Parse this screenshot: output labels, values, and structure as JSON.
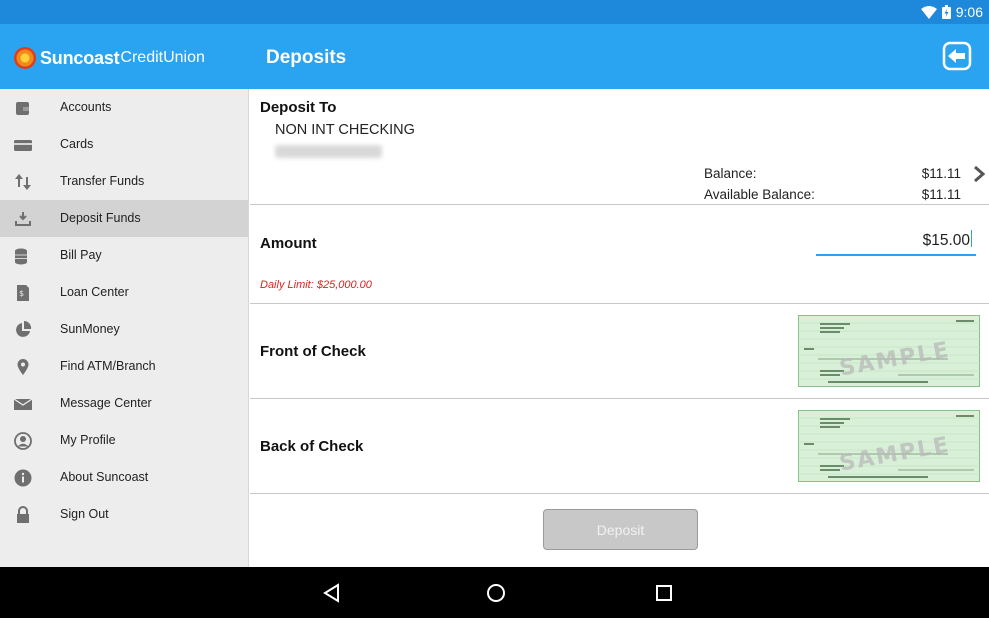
{
  "status_bar": {
    "time": "9:06",
    "wifi_icon": "wifi-icon",
    "battery_icon": "battery-icon"
  },
  "app_bar": {
    "logo_bold": "Suncoast",
    "logo_light": "CreditUnion",
    "title": "Deposits",
    "exit_icon": "logout-icon"
  },
  "sidebar": {
    "items": [
      {
        "label": "Accounts",
        "icon": "wallet-icon"
      },
      {
        "label": "Cards",
        "icon": "credit-card-icon"
      },
      {
        "label": "Transfer Funds",
        "icon": "transfer-arrows-icon"
      },
      {
        "label": "Deposit Funds",
        "icon": "deposit-tray-icon",
        "active": true
      },
      {
        "label": "Bill Pay",
        "icon": "coins-stack-icon"
      },
      {
        "label": "Loan Center",
        "icon": "loan-document-icon"
      },
      {
        "label": "SunMoney",
        "icon": "pie-chart-icon"
      },
      {
        "label": "Find ATM/Branch",
        "icon": "map-pin-icon"
      },
      {
        "label": "Message Center",
        "icon": "envelope-icon"
      },
      {
        "label": "My Profile",
        "icon": "user-circle-icon"
      },
      {
        "label": "About Suncoast",
        "icon": "info-icon"
      },
      {
        "label": "Sign Out",
        "icon": "lock-icon"
      }
    ]
  },
  "deposit_to": {
    "label": "Deposit To",
    "account_name": "NON INT CHECKING",
    "balance_label": "Balance:",
    "balance_value": "$11.11",
    "available_label": "Available Balance:",
    "available_value": "$11.11"
  },
  "amount": {
    "label": "Amount",
    "value": "$15.00",
    "daily_limit": "Daily Limit: $25,000.00"
  },
  "front_check": {
    "label": "Front of Check",
    "image": "sample-check-image"
  },
  "back_check": {
    "label": "Back of Check",
    "image": "sample-check-image"
  },
  "deposit_button": {
    "label": "Deposit"
  },
  "colors": {
    "app_bar": "#2AA3F1",
    "status_bar": "#1E88DB",
    "limit_text": "#E02020",
    "sidebar_bg": "#EDEDED",
    "sidebar_active": "#D3D3D3"
  }
}
